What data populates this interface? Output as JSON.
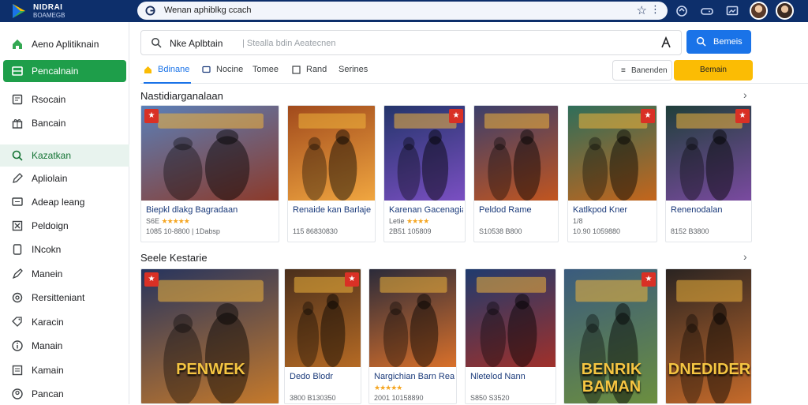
{
  "app": {
    "logo_line1": "NIDRAI",
    "logo_line2": "BOAMEGB"
  },
  "omnibox": {
    "url": "Wenan aphiblkg ccach"
  },
  "sidebar": {
    "items": [
      {
        "label": "Aeno Aplitiknain",
        "icon": "home-icon"
      },
      {
        "label": "Pencalnain",
        "icon": "apps-grid-icon"
      },
      {
        "label": "Rsocain",
        "icon": "document-icon"
      },
      {
        "label": "Bancain",
        "icon": "gift-icon"
      },
      {
        "label": "Kazatkan",
        "icon": "search-icon"
      },
      {
        "label": "Apliolain",
        "icon": "pencil-icon"
      },
      {
        "label": "Adeap leang",
        "icon": "monitor-icon"
      },
      {
        "label": "Peldoign",
        "icon": "close-box-icon"
      },
      {
        "label": "INcokn",
        "icon": "tablet-icon"
      },
      {
        "label": "Manein",
        "icon": "pen-icon"
      },
      {
        "label": "Rersitteniant",
        "icon": "settings-icon"
      },
      {
        "label": "Karacin",
        "icon": "tag-icon"
      },
      {
        "label": "Manain",
        "icon": "info-icon"
      },
      {
        "label": "Kamain",
        "icon": "list-box-icon"
      },
      {
        "label": "Pancan",
        "icon": "user-icon"
      }
    ]
  },
  "search": {
    "value": "Nke Aplbtain",
    "placeholder": "| Stealla bdin Aeatecnen",
    "button_label": "Bemeis"
  },
  "tabs": [
    {
      "label": "Bdinane",
      "icon": "home-icon",
      "active": true
    },
    {
      "label": "Nocine",
      "icon": "monitor-icon",
      "active": false
    },
    {
      "label": "Tomee",
      "icon": "",
      "active": false
    },
    {
      "label": "Rand",
      "icon": "checkbox-icon",
      "active": false
    },
    {
      "label": "Serines",
      "icon": "",
      "active": false
    }
  ],
  "actions": {
    "outline_label": "Banenden",
    "yellow_label": "Bemain"
  },
  "sections": [
    {
      "title": "Nastidiarganalaan",
      "cards": [
        {
          "title": "Biepkl dlakg Bagradaan",
          "rating": "S6E",
          "stars": "★★★★★",
          "count": "1085 10-8800 | 1Dabsp",
          "art": [
            "#5a7fb8",
            "#8c3a2a"
          ]
        },
        {
          "title": "Renaide kan Barlaje",
          "rating": "",
          "stars": "",
          "count": "115 86830830",
          "art": [
            "#a14a1c",
            "#f0a640"
          ]
        },
        {
          "title": "Karenan Gacenagian",
          "rating": "Letie",
          "stars": "★★★★",
          "count": "2B51 105809",
          "art": [
            "#24356b",
            "#7a4fc2"
          ]
        },
        {
          "title": "Peldod Rame",
          "rating": "",
          "stars": "",
          "count": "S10538 B800",
          "art": [
            "#3c3f6b",
            "#c2551f"
          ]
        },
        {
          "title": "Katlkpod Kner",
          "rating": "1/8",
          "stars": "",
          "count": "10.90 1059880",
          "art": [
            "#2f6e5a",
            "#c4651b"
          ]
        },
        {
          "title": "Renenodalan",
          "rating": "",
          "stars": "",
          "count": "8152 B3800",
          "art": [
            "#1f3f3a",
            "#7a4aa0"
          ]
        }
      ]
    },
    {
      "title": "Seele Kestarie",
      "cards": [
        {
          "title": "",
          "rating": "",
          "stars": "",
          "count": "",
          "art": [
            "#26345e",
            "#c77a2a"
          ],
          "poster": "PENWEK"
        },
        {
          "title": "Dedo Blodr",
          "rating": "",
          "stars": "",
          "count": "3800 B130350",
          "art": [
            "#4a2f1c",
            "#b56a24"
          ]
        },
        {
          "title": "Nargichian Barn Real",
          "rating": "",
          "stars": "★★★★★",
          "count": "2001 10158890",
          "art": [
            "#2b2b3a",
            "#d9702a"
          ]
        },
        {
          "title": "Nletelod Nann",
          "rating": "",
          "stars": "",
          "count": "S850 S3520",
          "art": [
            "#1f3b6e",
            "#a0302a"
          ]
        },
        {
          "title": "",
          "rating": "",
          "stars": "",
          "count": "",
          "art": [
            "#3a5b7e",
            "#6c8f3e"
          ],
          "poster": "BENRIK BAMAN"
        },
        {
          "title": "",
          "rating": "",
          "stars": "",
          "count": "",
          "art": [
            "#2a2422",
            "#c76b2a"
          ],
          "poster": "DNEDIDER"
        }
      ]
    }
  ]
}
